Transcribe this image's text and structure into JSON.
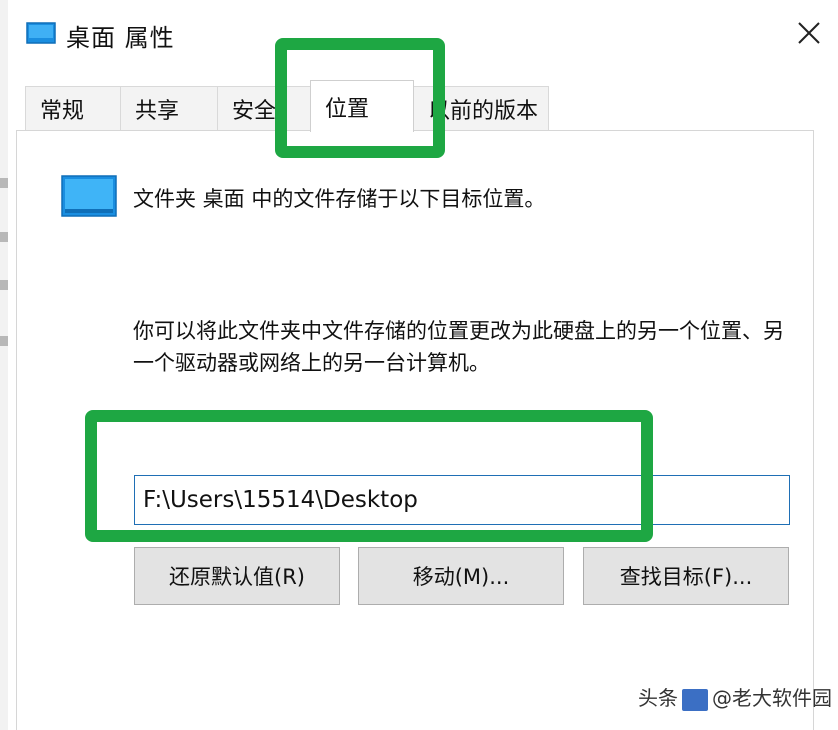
{
  "window": {
    "title": "桌面 属性",
    "close_label": "✕"
  },
  "tabs": [
    {
      "label": "常规",
      "active": false
    },
    {
      "label": "共享",
      "active": false
    },
    {
      "label": "安全",
      "active": false
    },
    {
      "label": "位置",
      "active": true
    },
    {
      "label": "以前的版本",
      "active": false
    }
  ],
  "location": {
    "intro": "文件夹 桌面 中的文件存储于以下目标位置。",
    "description": "你可以将此文件夹中文件存储的位置更改为此硬盘上的另一个位置、另一个驱动器或网络上的另一台计算机。",
    "path_value": "F:\\Users\\15514\\Desktop"
  },
  "buttons": {
    "restore_default": "还原默认值(R)",
    "move": "移动(M)...",
    "find_target": "查找目标(F)..."
  },
  "icons": {
    "title_icon": "folder-desktop-icon",
    "content_icon": "folder-desktop-icon"
  },
  "colors": {
    "highlight": "#1ea743",
    "icon_blue": "#1a8ee0",
    "input_border": "#1f6fb5"
  },
  "watermark": {
    "prefix": "头条",
    "text": "@老大软件园"
  }
}
